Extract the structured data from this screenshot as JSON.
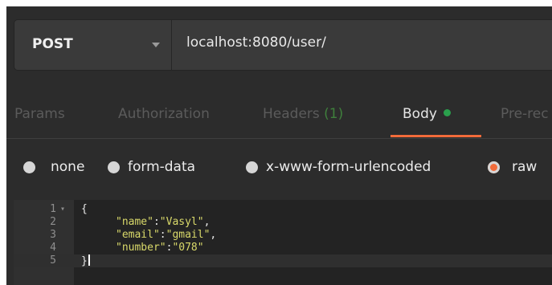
{
  "request": {
    "method": "POST",
    "url": "localhost:8080/user/"
  },
  "tabs": [
    {
      "label": "Params"
    },
    {
      "label": "Authorization"
    },
    {
      "label": "Headers",
      "count": "(1)"
    },
    {
      "label": "Body"
    },
    {
      "label": "Pre-rec"
    }
  ],
  "body_types": [
    {
      "label": "none",
      "selected": false
    },
    {
      "label": "form-data",
      "selected": false
    },
    {
      "label": "x-www-form-urlencoded",
      "selected": false
    },
    {
      "label": "raw",
      "selected": true
    }
  ],
  "editor": {
    "line_numbers": [
      "1",
      "2",
      "3",
      "4",
      "5"
    ],
    "open_brace": "{",
    "close_brace": "}",
    "fields": [
      {
        "key": "\"name\"",
        "value": "\"Vasyl\"",
        "sep": ":",
        "trail": ","
      },
      {
        "key": "\"email\"",
        "value": "\"gmail\"",
        "sep": ":",
        "trail": ","
      },
      {
        "key": "\"number\"",
        "value": "\"078\"",
        "sep": ":",
        "trail": ""
      }
    ]
  },
  "colors": {
    "accent": "#f26b3a",
    "body_dot": "#2aa04c",
    "header_count": "#3f7f3c",
    "json_string": "#d9d96a"
  }
}
